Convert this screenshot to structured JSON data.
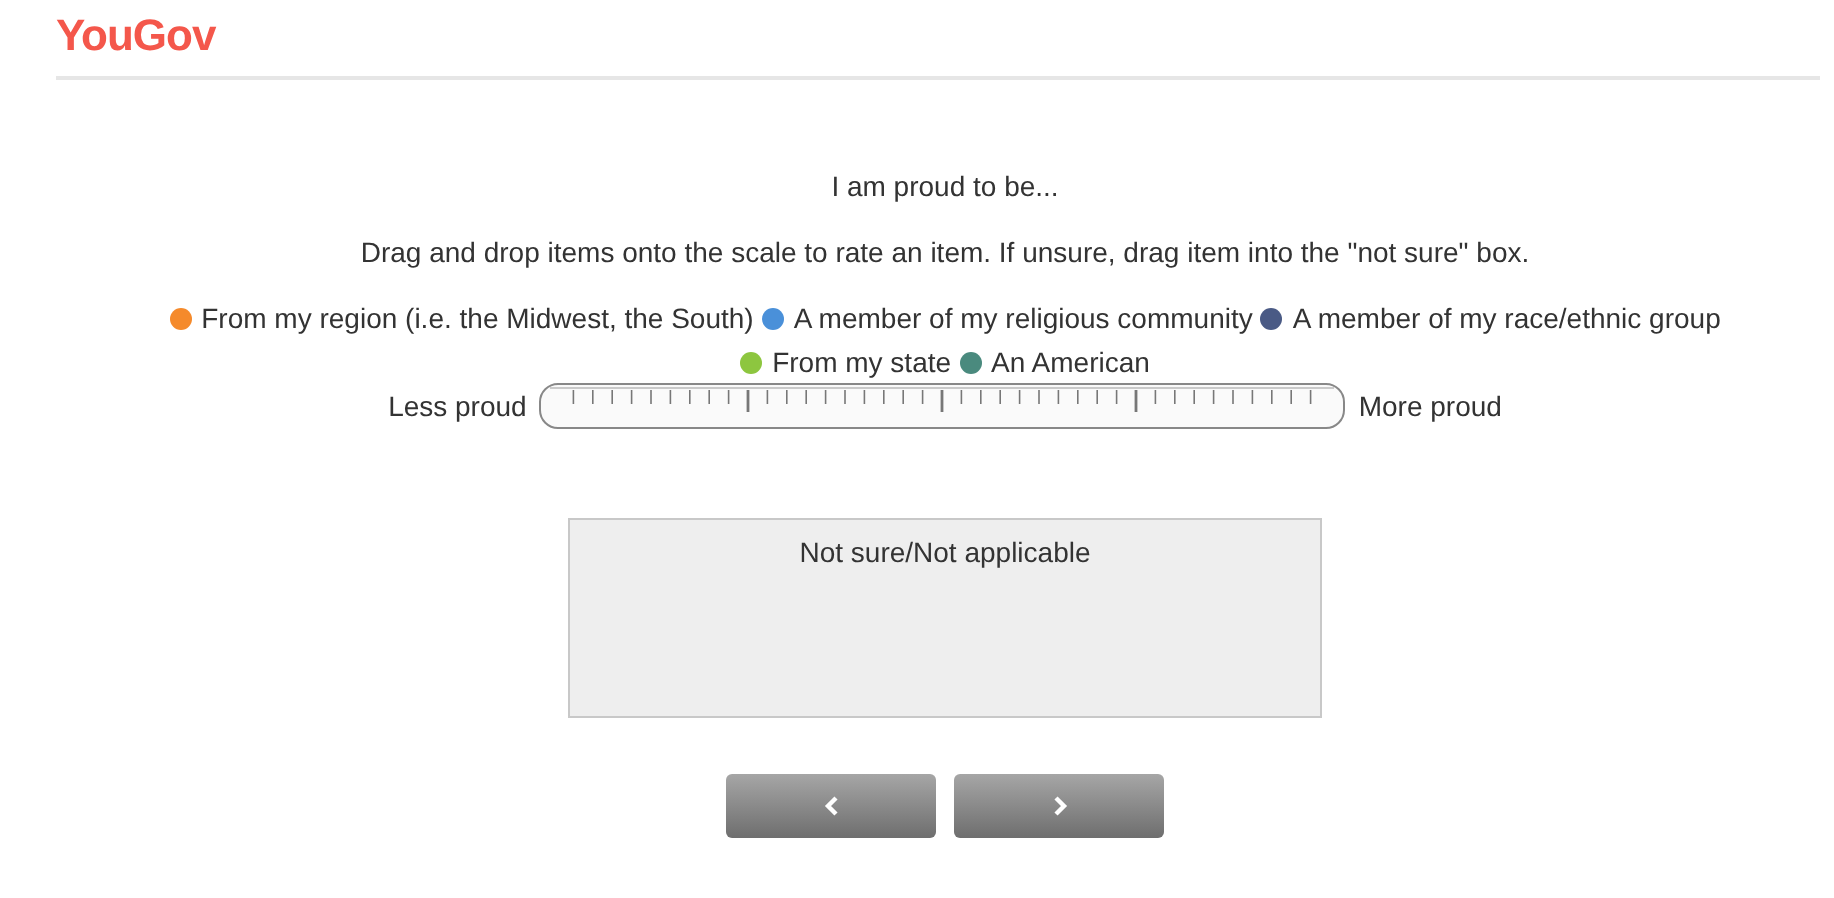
{
  "header": {
    "logo": "YouGov"
  },
  "question": {
    "title": "I am proud to be...",
    "instruction": "Drag and drop items onto the scale to rate an item. If unsure, drag item into the \"not sure\" box.",
    "items": [
      {
        "label": "From my region (i.e. the Midwest, the South)",
        "color": "#f58a2b"
      },
      {
        "label": "A member of my religious community",
        "color": "#4a90d9"
      },
      {
        "label": "A member of my race/ethnic group",
        "color": "#4a5a85"
      },
      {
        "label": "From my state",
        "color": "#8dc63f"
      },
      {
        "label": "An American",
        "color": "#4a8a7e"
      }
    ],
    "scale": {
      "left_label": "Less proud",
      "right_label": "More proud"
    },
    "not_sure_box": {
      "label": "Not sure/Not applicable"
    }
  },
  "navigation": {
    "buttons": [
      {
        "kind": "back"
      },
      {
        "kind": "next"
      }
    ]
  }
}
